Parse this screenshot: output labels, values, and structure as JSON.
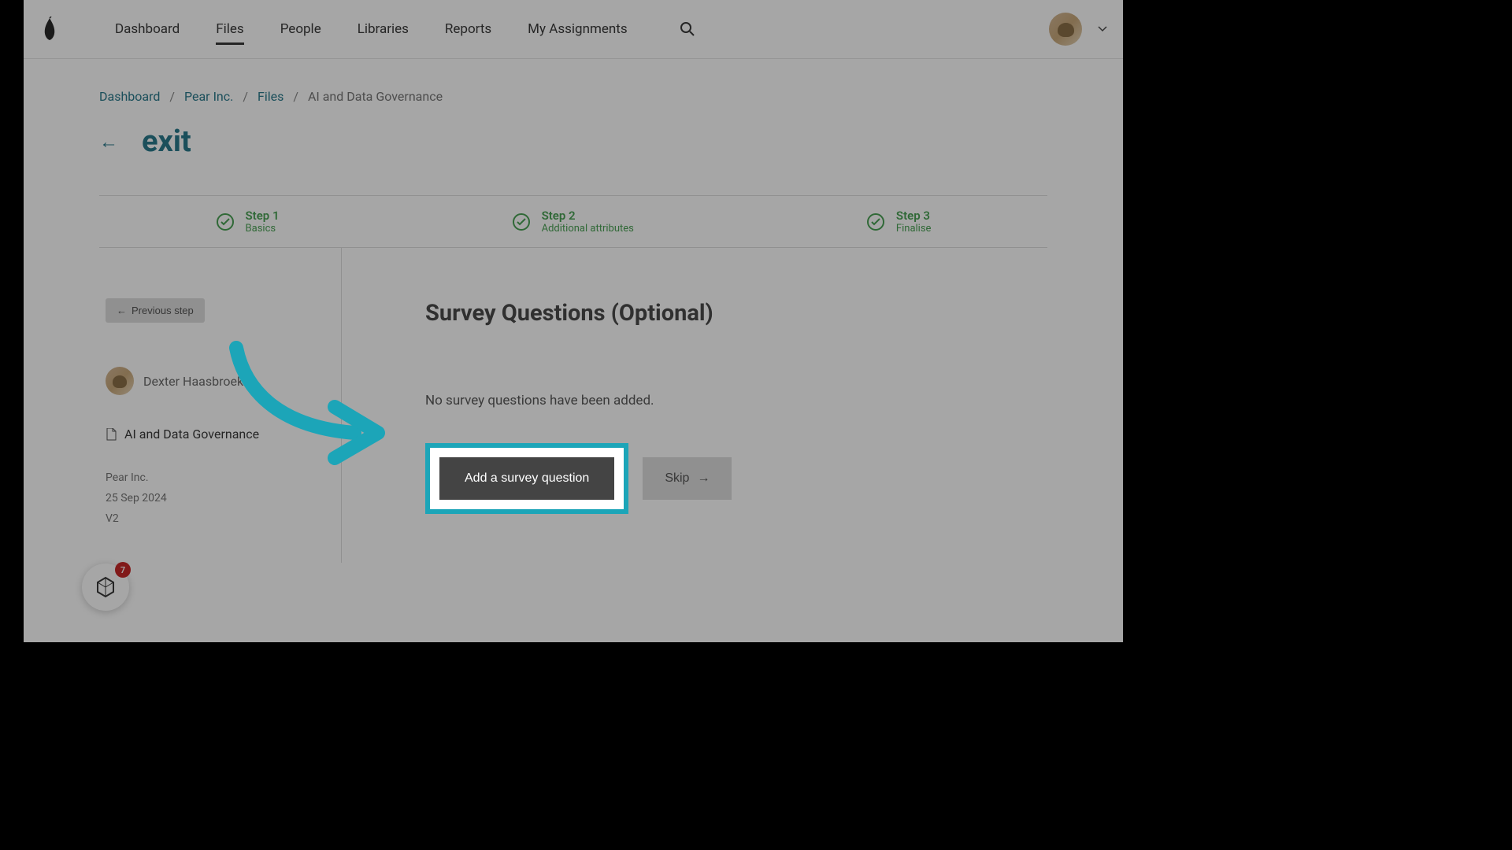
{
  "nav": {
    "items": [
      "Dashboard",
      "Files",
      "People",
      "Libraries",
      "Reports",
      "My Assignments"
    ]
  },
  "breadcrumb": {
    "items": [
      "Dashboard",
      "Pear Inc.",
      "Files"
    ],
    "current": "AI and Data Governance"
  },
  "exit": {
    "label": "exit"
  },
  "steps": [
    {
      "title": "Step 1",
      "subtitle": "Basics"
    },
    {
      "title": "Step 2",
      "subtitle": "Additional attributes"
    },
    {
      "title": "Step 3",
      "subtitle": "Finalise"
    }
  ],
  "sidebar": {
    "prev_label": "Previous step",
    "user_name": "Dexter Haasbroek",
    "doc_name": "AI and Data Governance",
    "company": "Pear Inc.",
    "date": "25 Sep 2024",
    "version": "V2"
  },
  "panel": {
    "title": "Survey Questions (Optional)",
    "subtitle": "No survey questions have been added.",
    "add_label": "Add a survey question",
    "skip_label": "Skip"
  },
  "widget": {
    "count": "7"
  }
}
